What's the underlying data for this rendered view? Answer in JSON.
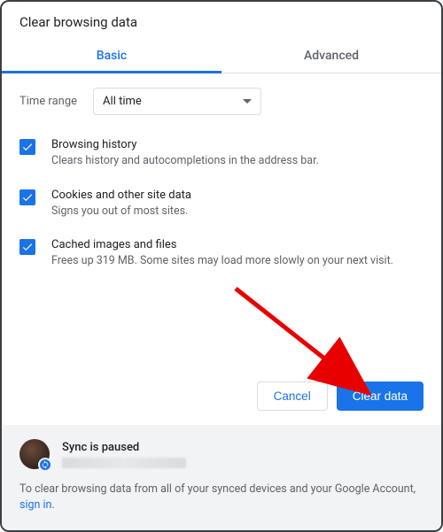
{
  "dialog": {
    "title": "Clear browsing data"
  },
  "tabs": {
    "basic": "Basic",
    "advanced": "Advanced"
  },
  "time_range": {
    "label": "Time range",
    "value": "All time"
  },
  "options": [
    {
      "title": "Browsing history",
      "desc": "Clears history and autocompletions in the address bar."
    },
    {
      "title": "Cookies and other site data",
      "desc": "Signs you out of most sites."
    },
    {
      "title": "Cached images and files",
      "desc": "Frees up 319 MB. Some sites may load more slowly on your next visit."
    }
  ],
  "actions": {
    "cancel": "Cancel",
    "clear": "Clear data"
  },
  "footer": {
    "sync_status": "Sync is paused",
    "note": "To clear browsing data from all of your synced devices and your Google Account, ",
    "sign_in": "sign in",
    "period": "."
  },
  "colors": {
    "accent": "#1a73e8"
  }
}
